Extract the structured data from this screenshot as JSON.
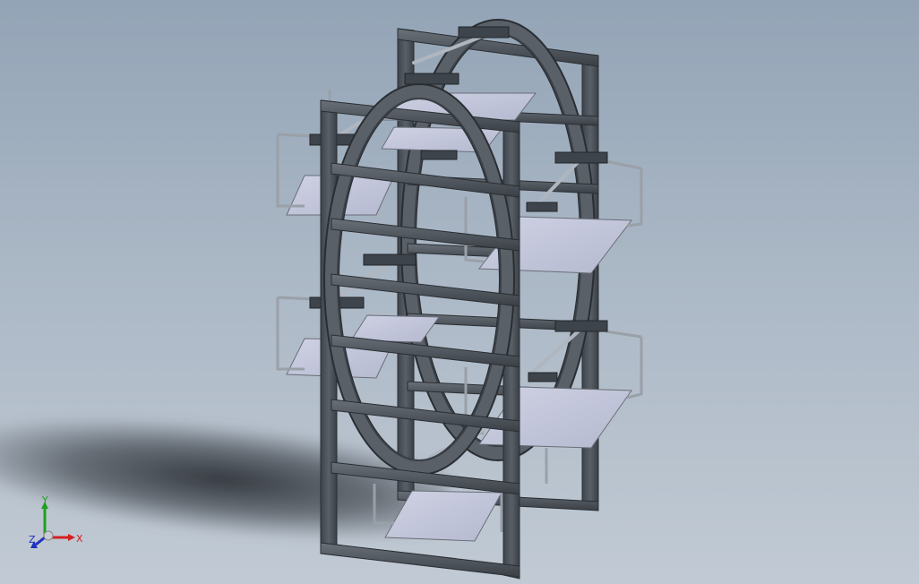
{
  "viewport": {
    "background_top": "#93a4b6",
    "background_bottom": "#c1cad4"
  },
  "model": {
    "frame_color": "#4a5058",
    "frame_edge": "#2a2e33",
    "panel_color": "#c4c8dc",
    "panel_edge": "#6a6e78",
    "rod_color": "#b0b6bf"
  },
  "triad": {
    "x_label": "X",
    "y_label": "Y",
    "z_label": "Z",
    "x_color": "#d42020",
    "y_color": "#20a020",
    "z_color": "#2030c0"
  }
}
